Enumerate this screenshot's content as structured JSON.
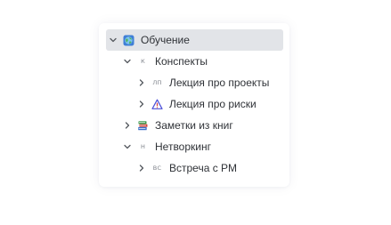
{
  "tree": {
    "items": [
      {
        "label": "Обучение",
        "icon": "globe-icon",
        "icon_text": "",
        "expanded": true,
        "selected": true
      },
      {
        "label": "Конспекты",
        "icon": "letter-icon",
        "icon_text": "К",
        "expanded": true,
        "selected": false
      },
      {
        "label": "Лекция про проекты",
        "icon": "letter-icon",
        "icon_text": "ЛП",
        "expanded": false,
        "selected": false
      },
      {
        "label": "Лекция про риски",
        "icon": "warning-icon",
        "icon_text": "",
        "expanded": false,
        "selected": false
      },
      {
        "label": "Заметки из книг",
        "icon": "books-icon",
        "icon_text": "",
        "expanded": false,
        "selected": false
      },
      {
        "label": "Нетворкинг",
        "icon": "letter-icon",
        "icon_text": "Н",
        "expanded": true,
        "selected": false
      },
      {
        "label": "Встреча с PM",
        "icon": "letter-icon",
        "icon_text": "ВС",
        "expanded": false,
        "selected": false
      }
    ]
  },
  "colors": {
    "selected_row": "#e2e4e8",
    "text": "#2f3237",
    "chevron": "#55595f",
    "warning": "#4b4fd8"
  }
}
